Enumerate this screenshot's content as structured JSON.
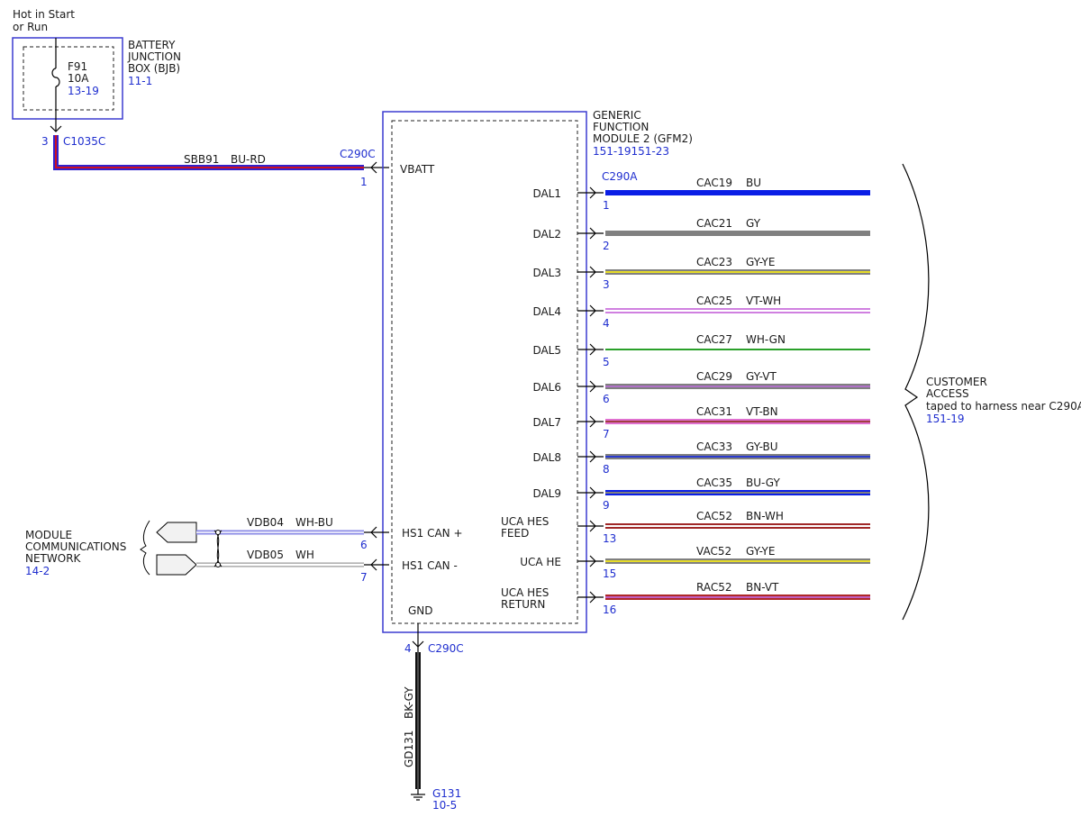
{
  "battery": {
    "hot_line1": "Hot in Start",
    "hot_line2": "or Run",
    "fuse": "F91",
    "rating": "10A",
    "fuse_ref": "13-19",
    "box_line1": "BATTERY",
    "box_line2": "JUNCTION",
    "box_line3": "BOX (BJB)",
    "box_ref": "11-1",
    "pin": "3",
    "connector": "C1035C"
  },
  "supply": {
    "circuit": "SBB91",
    "color": "BU-RD",
    "connector": "C290C",
    "pin": "1",
    "pin_name": "VBATT"
  },
  "module": {
    "line1": "GENERIC",
    "line2": "FUNCTION",
    "line3": "MODULE 2 (GFM2)",
    "ref": "151-19151-23",
    "output_connector": "C290A"
  },
  "outputs": [
    {
      "pin_name": "DAL1",
      "pin": "1",
      "circuit": "CAC19",
      "color": "BU",
      "c1": "#0a1ee6",
      "c2": "#0a1ee6"
    },
    {
      "pin_name": "DAL2",
      "pin": "2",
      "circuit": "CAC21",
      "color": "GY",
      "c1": "#808080",
      "c2": "#808080"
    },
    {
      "pin_name": "DAL3",
      "pin": "3",
      "circuit": "CAC23",
      "color": "GY-YE",
      "c1": "#808080",
      "c2": "#e6dc28"
    },
    {
      "pin_name": "DAL4",
      "pin": "4",
      "circuit": "CAC25",
      "color": "VT-WH",
      "c1": "#d080e0",
      "c2": "#ffffff"
    },
    {
      "pin_name": "DAL5",
      "pin": "5",
      "circuit": "CAC27",
      "color": "WH-GN",
      "c1": "#ffffff",
      "c2": "#2aa02a"
    },
    {
      "pin_name": "DAL6",
      "pin": "6",
      "circuit": "CAC29",
      "color": "GY-VT",
      "c1": "#808080",
      "c2": "#b070c8"
    },
    {
      "pin_name": "DAL7",
      "pin": "7",
      "circuit": "CAC31",
      "color": "VT-BN",
      "c1": "#e070d0",
      "c2": "#a04040"
    },
    {
      "pin_name": "DAL8",
      "pin": "8",
      "circuit": "CAC33",
      "color": "GY-BU",
      "c1": "#808080",
      "c2": "#2a3ad0"
    },
    {
      "pin_name": "DAL9",
      "pin": "9",
      "circuit": "CAC35",
      "color": "BU-GY",
      "c1": "#0a1ee6",
      "c2": "#808080"
    },
    {
      "pin_name": "UCA HES|FEED",
      "pin": "13",
      "circuit": "CAC52",
      "color": "BN-WH",
      "c1": "#a02828",
      "c2": "#ffffff"
    },
    {
      "pin_name": "UCA HE",
      "pin": "15",
      "circuit": "VAC52",
      "color": "GY-YE",
      "c1": "#808080",
      "c2": "#e6dc28"
    },
    {
      "pin_name": "UCA HES|RETURN",
      "pin": "16",
      "circuit": "RAC52",
      "color": "BN-VT",
      "c1": "#b02828",
      "c2": "#c060c0"
    }
  ],
  "customer_access": {
    "line1": "CUSTOMER",
    "line2": "ACCESS",
    "line3": "taped to harness near C290A",
    "ref": "151-19"
  },
  "network": {
    "line1": "MODULE",
    "line2": "COMMUNICATIONS",
    "line3": "NETWORK",
    "ref": "14-2",
    "can_high": {
      "circuit": "VDB04",
      "color": "WH-BU",
      "pin": "6",
      "pin_name": "HS1 CAN +"
    },
    "can_low": {
      "circuit": "VDB05",
      "color": "WH",
      "pin": "7",
      "pin_name": "HS1 CAN -"
    }
  },
  "ground": {
    "pin_name": "GND",
    "pin": "4",
    "connector": "C290C",
    "circuit": "GD131",
    "color": "BK-GY",
    "point": "G131",
    "ref": "10-5"
  }
}
